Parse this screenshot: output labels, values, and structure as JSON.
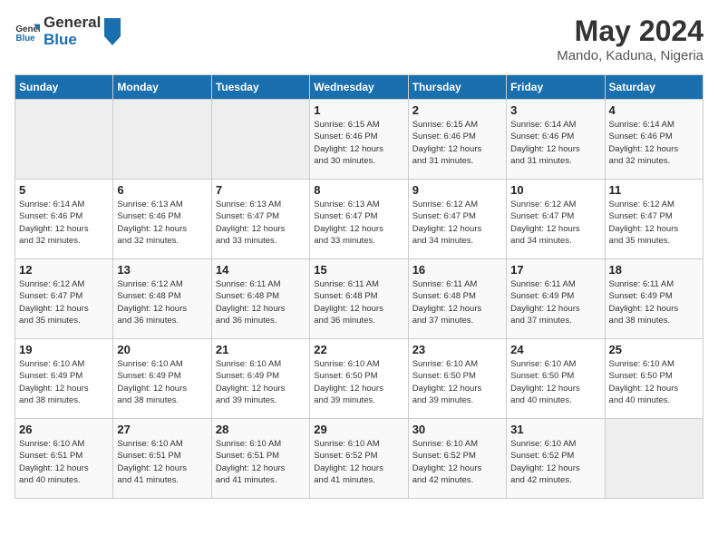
{
  "logo": {
    "text_general": "General",
    "text_blue": "Blue"
  },
  "title": "May 2024",
  "location": "Mando, Kaduna, Nigeria",
  "days_of_week": [
    "Sunday",
    "Monday",
    "Tuesday",
    "Wednesday",
    "Thursday",
    "Friday",
    "Saturday"
  ],
  "weeks": [
    [
      {
        "day": "",
        "info": ""
      },
      {
        "day": "",
        "info": ""
      },
      {
        "day": "",
        "info": ""
      },
      {
        "day": "1",
        "info": "Sunrise: 6:15 AM\nSunset: 6:46 PM\nDaylight: 12 hours\nand 30 minutes."
      },
      {
        "day": "2",
        "info": "Sunrise: 6:15 AM\nSunset: 6:46 PM\nDaylight: 12 hours\nand 31 minutes."
      },
      {
        "day": "3",
        "info": "Sunrise: 6:14 AM\nSunset: 6:46 PM\nDaylight: 12 hours\nand 31 minutes."
      },
      {
        "day": "4",
        "info": "Sunrise: 6:14 AM\nSunset: 6:46 PM\nDaylight: 12 hours\nand 32 minutes."
      }
    ],
    [
      {
        "day": "5",
        "info": "Sunrise: 6:14 AM\nSunset: 6:46 PM\nDaylight: 12 hours\nand 32 minutes."
      },
      {
        "day": "6",
        "info": "Sunrise: 6:13 AM\nSunset: 6:46 PM\nDaylight: 12 hours\nand 32 minutes."
      },
      {
        "day": "7",
        "info": "Sunrise: 6:13 AM\nSunset: 6:47 PM\nDaylight: 12 hours\nand 33 minutes."
      },
      {
        "day": "8",
        "info": "Sunrise: 6:13 AM\nSunset: 6:47 PM\nDaylight: 12 hours\nand 33 minutes."
      },
      {
        "day": "9",
        "info": "Sunrise: 6:12 AM\nSunset: 6:47 PM\nDaylight: 12 hours\nand 34 minutes."
      },
      {
        "day": "10",
        "info": "Sunrise: 6:12 AM\nSunset: 6:47 PM\nDaylight: 12 hours\nand 34 minutes."
      },
      {
        "day": "11",
        "info": "Sunrise: 6:12 AM\nSunset: 6:47 PM\nDaylight: 12 hours\nand 35 minutes."
      }
    ],
    [
      {
        "day": "12",
        "info": "Sunrise: 6:12 AM\nSunset: 6:47 PM\nDaylight: 12 hours\nand 35 minutes."
      },
      {
        "day": "13",
        "info": "Sunrise: 6:12 AM\nSunset: 6:48 PM\nDaylight: 12 hours\nand 36 minutes."
      },
      {
        "day": "14",
        "info": "Sunrise: 6:11 AM\nSunset: 6:48 PM\nDaylight: 12 hours\nand 36 minutes."
      },
      {
        "day": "15",
        "info": "Sunrise: 6:11 AM\nSunset: 6:48 PM\nDaylight: 12 hours\nand 36 minutes."
      },
      {
        "day": "16",
        "info": "Sunrise: 6:11 AM\nSunset: 6:48 PM\nDaylight: 12 hours\nand 37 minutes."
      },
      {
        "day": "17",
        "info": "Sunrise: 6:11 AM\nSunset: 6:49 PM\nDaylight: 12 hours\nand 37 minutes."
      },
      {
        "day": "18",
        "info": "Sunrise: 6:11 AM\nSunset: 6:49 PM\nDaylight: 12 hours\nand 38 minutes."
      }
    ],
    [
      {
        "day": "19",
        "info": "Sunrise: 6:10 AM\nSunset: 6:49 PM\nDaylight: 12 hours\nand 38 minutes."
      },
      {
        "day": "20",
        "info": "Sunrise: 6:10 AM\nSunset: 6:49 PM\nDaylight: 12 hours\nand 38 minutes."
      },
      {
        "day": "21",
        "info": "Sunrise: 6:10 AM\nSunset: 6:49 PM\nDaylight: 12 hours\nand 39 minutes."
      },
      {
        "day": "22",
        "info": "Sunrise: 6:10 AM\nSunset: 6:50 PM\nDaylight: 12 hours\nand 39 minutes."
      },
      {
        "day": "23",
        "info": "Sunrise: 6:10 AM\nSunset: 6:50 PM\nDaylight: 12 hours\nand 39 minutes."
      },
      {
        "day": "24",
        "info": "Sunrise: 6:10 AM\nSunset: 6:50 PM\nDaylight: 12 hours\nand 40 minutes."
      },
      {
        "day": "25",
        "info": "Sunrise: 6:10 AM\nSunset: 6:50 PM\nDaylight: 12 hours\nand 40 minutes."
      }
    ],
    [
      {
        "day": "26",
        "info": "Sunrise: 6:10 AM\nSunset: 6:51 PM\nDaylight: 12 hours\nand 40 minutes."
      },
      {
        "day": "27",
        "info": "Sunrise: 6:10 AM\nSunset: 6:51 PM\nDaylight: 12 hours\nand 41 minutes."
      },
      {
        "day": "28",
        "info": "Sunrise: 6:10 AM\nSunset: 6:51 PM\nDaylight: 12 hours\nand 41 minutes."
      },
      {
        "day": "29",
        "info": "Sunrise: 6:10 AM\nSunset: 6:52 PM\nDaylight: 12 hours\nand 41 minutes."
      },
      {
        "day": "30",
        "info": "Sunrise: 6:10 AM\nSunset: 6:52 PM\nDaylight: 12 hours\nand 42 minutes."
      },
      {
        "day": "31",
        "info": "Sunrise: 6:10 AM\nSunset: 6:52 PM\nDaylight: 12 hours\nand 42 minutes."
      },
      {
        "day": "",
        "info": ""
      }
    ]
  ]
}
